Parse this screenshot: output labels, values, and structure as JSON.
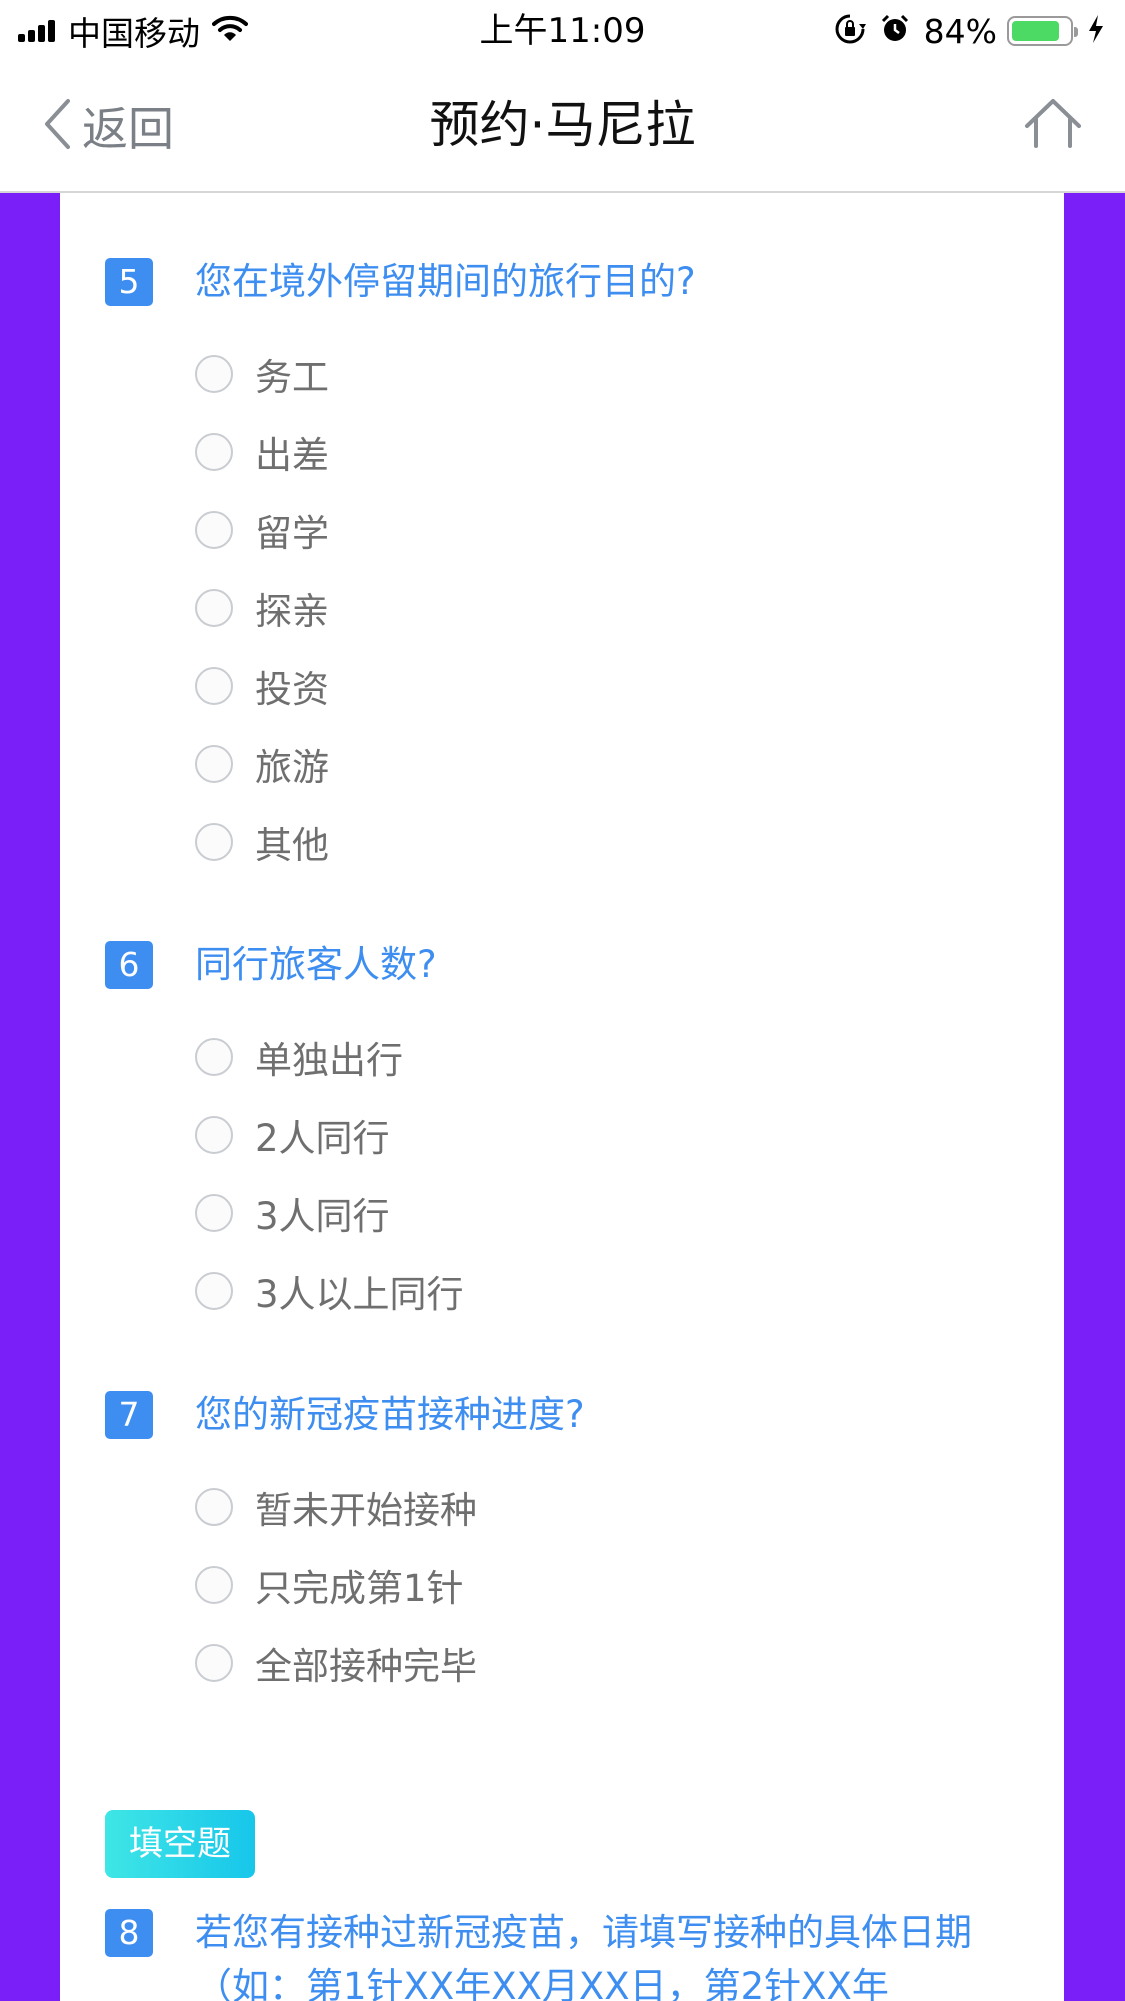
{
  "status_bar": {
    "carrier": "中国移动",
    "time": "上午11:09",
    "battery_percent": "84%",
    "battery_level": 0.84,
    "icons": [
      "signal-icon",
      "wifi-icon",
      "rotation-lock-icon",
      "alarm-icon",
      "battery-icon",
      "charging-icon"
    ]
  },
  "nav": {
    "back_label": "返回",
    "title": "预约·马尼拉",
    "home_icon": "home-icon"
  },
  "questions": [
    {
      "number": "5",
      "text": "您在境外停留期间的旅行目的?",
      "options": [
        "务工",
        "出差",
        "留学",
        "探亲",
        "投资",
        "旅游",
        "其他"
      ]
    },
    {
      "number": "6",
      "text": "同行旅客人数?",
      "options": [
        "单独出行",
        "2人同行",
        "3人同行",
        "3人以上同行"
      ]
    },
    {
      "number": "7",
      "text": "您的新冠疫苗接种进度?",
      "options": [
        "暂未开始接种",
        "只完成第1针",
        "全部接种完毕"
      ]
    }
  ],
  "fill_section": {
    "badge": "填空题",
    "number": "8",
    "text": "若您有接种过新冠疫苗，请填写接种的具体日期（如：第1针XX年XX月XX日，第2针XX年"
  },
  "colors": {
    "background": "#7a1ff7",
    "accent": "#3d8ef0",
    "badge_gradient_start": "#3fe6e6",
    "badge_gradient_end": "#17c6ea",
    "battery_fill": "#4cd964"
  }
}
